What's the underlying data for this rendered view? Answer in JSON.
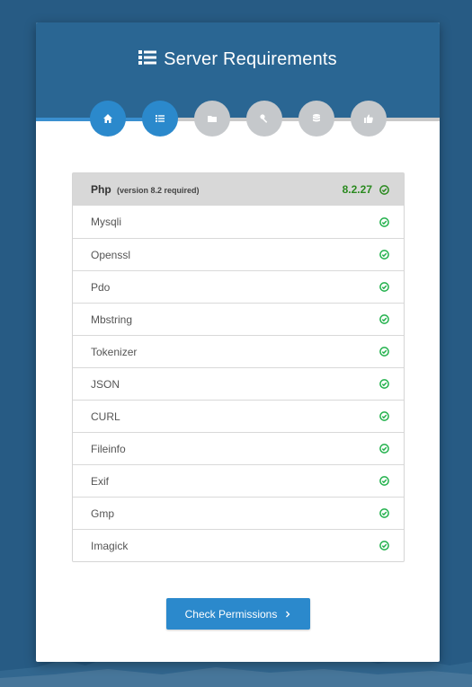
{
  "header": {
    "title": "Server Requirements",
    "title_icon": "list-icon"
  },
  "steps": [
    {
      "icon": "home-icon",
      "state": "active"
    },
    {
      "icon": "list-icon",
      "state": "active"
    },
    {
      "icon": "folder-icon",
      "state": "inactive"
    },
    {
      "icon": "key-icon",
      "state": "inactive"
    },
    {
      "icon": "database-icon",
      "state": "inactive"
    },
    {
      "icon": "thumbs-up-icon",
      "state": "inactive"
    }
  ],
  "php": {
    "name": "Php",
    "note": "(version 8.2 required)",
    "version": "8.2.27",
    "status": "ok"
  },
  "extensions": [
    {
      "name": "Mysqli",
      "status": "ok"
    },
    {
      "name": "Openssl",
      "status": "ok"
    },
    {
      "name": "Pdo",
      "status": "ok"
    },
    {
      "name": "Mbstring",
      "status": "ok"
    },
    {
      "name": "Tokenizer",
      "status": "ok"
    },
    {
      "name": "JSON",
      "status": "ok"
    },
    {
      "name": "CURL",
      "status": "ok"
    },
    {
      "name": "Fileinfo",
      "status": "ok"
    },
    {
      "name": "Exif",
      "status": "ok"
    },
    {
      "name": "Gmp",
      "status": "ok"
    },
    {
      "name": "Imagick",
      "status": "ok"
    }
  ],
  "action": {
    "label": "Check Permissions",
    "icon": "chevron-right-icon"
  },
  "colors": {
    "background": "#275b84",
    "header": "#2a6693",
    "accent": "#2b89cc",
    "inactive_step": "#c5c8cb",
    "success": "#2a8a1f",
    "check": "#22b14c"
  }
}
